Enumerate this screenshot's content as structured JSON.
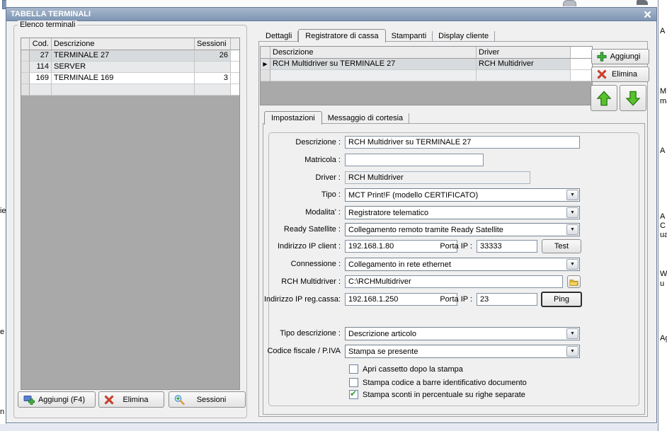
{
  "window": {
    "title": "TABELLA TERMINALI"
  },
  "icons": {
    "close": "x-white",
    "dropdown_arrow": "▼",
    "row_marker": "▶",
    "check_mark": "✔",
    "add": "plus-green",
    "delete": "x-red",
    "move_up": "arrow-up-green",
    "move_down": "arrow-down-green",
    "folder": "folder-yellow",
    "sessions": "magnifier-plus",
    "add_terminal": "terminal-plus"
  },
  "colors": {
    "titlebar": "#8399b6",
    "dialog_bg": "#f0f0f0",
    "accent_green": "#3cb13c",
    "accent_red": "#d9402b",
    "grid_filler": "#a9a9a9",
    "selected_row": "#ffffff"
  },
  "terminals": {
    "group_label": "Elenco terminali",
    "columns": {
      "cod": "Cod.",
      "desc": "Descrizione",
      "sessions": "Sessioni"
    },
    "rows": [
      {
        "cod": "27",
        "desc": "TERMINALE 27",
        "sessions": "26"
      },
      {
        "cod": "114",
        "desc": "SERVER",
        "sessions": ""
      },
      {
        "cod": "169",
        "desc": "TERMINALE 169",
        "sessions": "3"
      },
      {
        "cod": "",
        "desc": "",
        "sessions": ""
      }
    ],
    "buttons": {
      "add": "Aggiungi (F4)",
      "delete": "Elimina",
      "sessions": "Sessioni"
    }
  },
  "detail": {
    "tabs": [
      "Dettagli",
      "Registratore di cassa",
      "Stampanti",
      "Display cliente"
    ],
    "active_tab": "Registratore di cassa",
    "grid": {
      "columns": {
        "desc": "Descrizione",
        "driver": "Driver"
      },
      "rows": [
        {
          "desc": "RCH Multidriver su TERMINALE 27",
          "driver": "RCH Multidriver"
        },
        {
          "desc": "",
          "driver": ""
        }
      ]
    },
    "buttons": {
      "add": "Aggiungi",
      "delete": "Elimina"
    }
  },
  "settings": {
    "tabs": [
      "Impostazioni",
      "Messaggio di cortesia"
    ],
    "active_tab": "Impostazioni",
    "fields": {
      "descrizione": {
        "label": "Descrizione :",
        "value": "RCH Multidriver su TERMINALE 27"
      },
      "matricola": {
        "label": "Matricola :",
        "value": ""
      },
      "driver": {
        "label": "Driver :",
        "value": "RCH Multidriver"
      },
      "tipo": {
        "label": "Tipo :",
        "value": "MCT Print!F (modello CERTIFICATO)"
      },
      "modalita": {
        "label": "Modalita' :",
        "value": "Registratore telematico"
      },
      "ready": {
        "label": "Ready Satellite :",
        "value": "Collegamento remoto tramite Ready Satellite"
      },
      "ip_client": {
        "label": "Indirizzo IP client :",
        "value": "192.168.1.80",
        "porta_label": "Porta IP :",
        "porta": "33333",
        "button": "Test"
      },
      "connessione": {
        "label": "Connessione :",
        "value": "Collegamento in rete ethernet"
      },
      "rch_path": {
        "label": "RCH Multidriver :",
        "value": "C:\\RCHMultidriver"
      },
      "ip_regcassa": {
        "label": "Indirizzo IP reg.cassa:",
        "value": "192.168.1.250",
        "porta_label": "Porta IP :",
        "porta": "23",
        "button": "Ping"
      },
      "tipo_descr": {
        "label": "Tipo descrizione :",
        "value": "Descrizione articolo"
      },
      "cod_fiscale": {
        "label": "Codice fiscale / P.IVA",
        "value": "Stampa se presente"
      }
    },
    "checkboxes": [
      {
        "label": "Apri cassetto dopo la stampa",
        "checked": false,
        "mark": ""
      },
      {
        "label": "Stampa codice a barre identificativo documento",
        "checked": false,
        "mark": ""
      },
      {
        "label": "Stampa sconti in percentuale su righe separate",
        "checked": true,
        "mark": "✔"
      }
    ]
  },
  "backdrop": {
    "right_fragments": [
      "A",
      "M",
      "ma",
      "A",
      "A",
      "C",
      "ua",
      "W",
      "u",
      "Ag"
    ],
    "left_fragments": [
      "ie",
      "e",
      "n"
    ]
  }
}
